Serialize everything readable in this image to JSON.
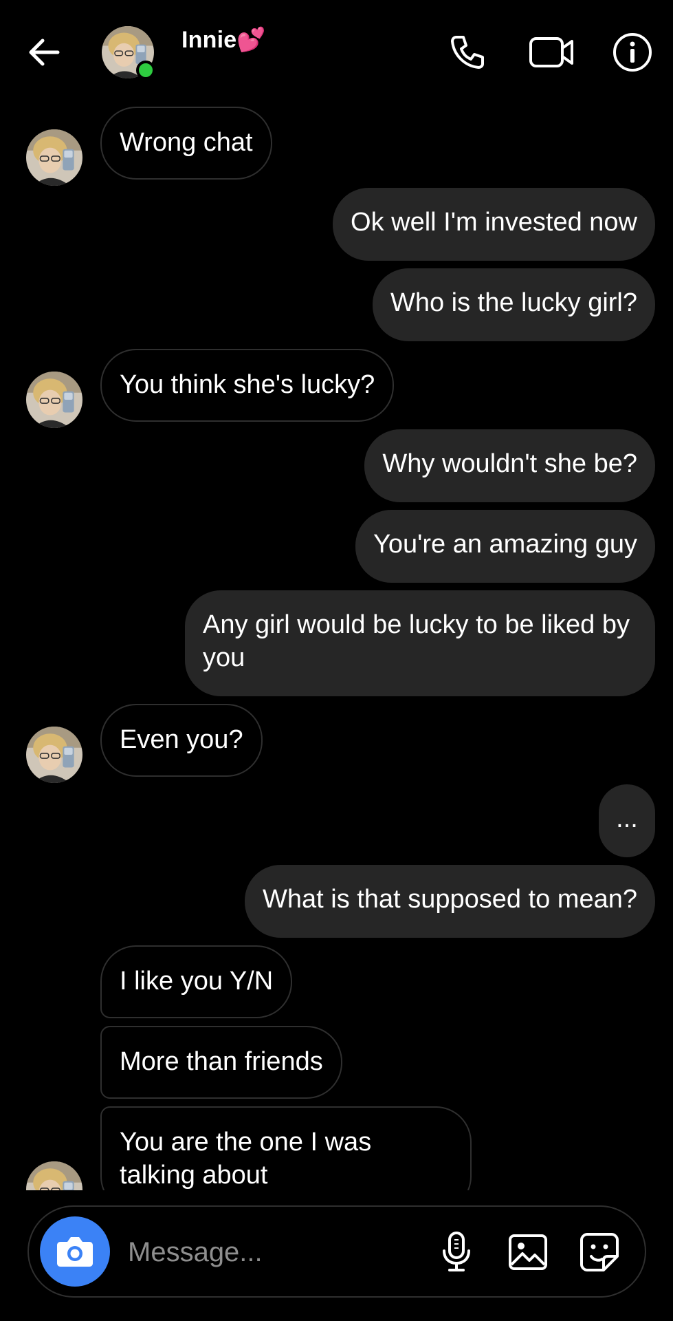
{
  "header": {
    "contact_name": "Innie💕",
    "online": true
  },
  "messages": [
    {
      "side": "in",
      "text": "Wrong chat"
    },
    {
      "side": "out",
      "text": "Ok well I'm invested now"
    },
    {
      "side": "out",
      "text": "Who is the lucky girl?"
    },
    {
      "side": "in",
      "text": "You think she's lucky?"
    },
    {
      "side": "out",
      "text": "Why wouldn't she be?"
    },
    {
      "side": "out",
      "text": "You're an amazing guy"
    },
    {
      "side": "out",
      "text": "Any girl would be  lucky to be liked by you"
    },
    {
      "side": "in",
      "text": "Even you?"
    },
    {
      "side": "out",
      "text": "..."
    },
    {
      "side": "out",
      "text": "What is that supposed to mean?"
    },
    {
      "side": "in",
      "text": "I like you Y/N"
    },
    {
      "side": "in",
      "text": "More than friends"
    },
    {
      "side": "in",
      "text": "You are the one I was talking about"
    }
  ],
  "composer": {
    "placeholder": "Message..."
  },
  "icons": {
    "back": "arrow-left-icon",
    "call": "phone-icon",
    "video": "video-camera-icon",
    "info": "info-icon",
    "camera": "camera-icon",
    "mic": "microphone-icon",
    "gallery": "image-icon",
    "sticker": "sticker-icon"
  },
  "colors": {
    "background": "#000000",
    "outgoing_bubble": "#262626",
    "incoming_border": "#2f2f2f",
    "camera_button": "#3b82f6",
    "online_dot": "#2ecc40"
  }
}
